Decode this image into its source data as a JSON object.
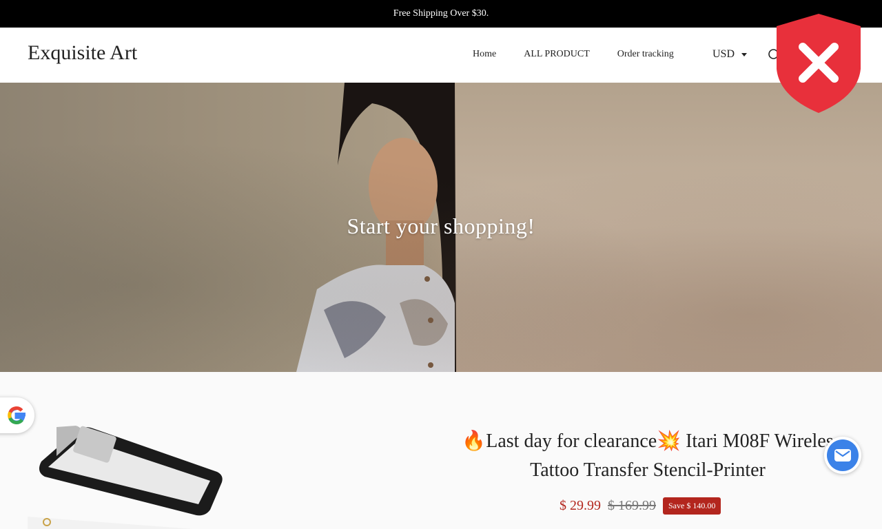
{
  "announcement": "Free Shipping Over $30.",
  "header": {
    "logo": "Exquisite Art",
    "nav": [
      "Home",
      "ALL PRODUCT",
      "Order tracking"
    ],
    "currency": "USD"
  },
  "hero": {
    "title": "Start your shopping!"
  },
  "product": {
    "title_line1": "🔥Last day for clearance💥 Itari M08F Wireles",
    "title_line2": "Tattoo Transfer Stencil-Printer",
    "price": "$ 29.99",
    "compare_price": "$ 169.99",
    "save_label": "Save $ 140.00"
  },
  "colors": {
    "accent": "#b3261e",
    "shield": "#e8303b",
    "mail": "#3b82e8"
  },
  "icons": {
    "search": "search-icon",
    "shield": "shield-close-icon",
    "google": "google-icon",
    "mail": "mail-icon"
  }
}
